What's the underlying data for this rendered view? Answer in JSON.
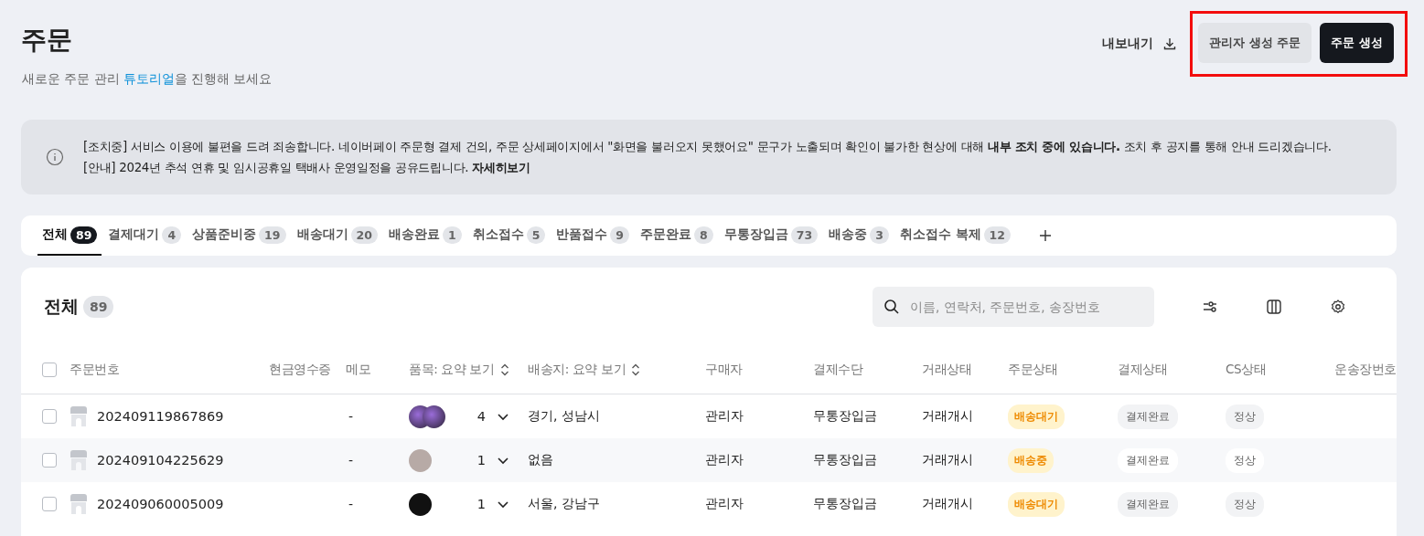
{
  "page": {
    "title": "주문",
    "subtitle_before": "새로운 주문 관리 ",
    "subtitle_link": "튜토리얼",
    "subtitle_after": "을 진행해 보세요"
  },
  "header_actions": {
    "export": "내보내기",
    "buttons": [
      {
        "label": "관리자 생성 주문",
        "kind": "secondary"
      },
      {
        "label": "주문 생성",
        "kind": "primary"
      }
    ]
  },
  "notice": {
    "lines": [
      "[조치중] 서비스 이용에 불편을 드려 죄송합니다. 네이버페이 주문형 결제 건의, 주문 상세페이지에서 \"화면을 불러오지 못했어요\" 문구가 노출되며 확인이 불가한 현상에 대해 **내부 조치 중에 있습니다.** 조치 후 공지를 통해 안내 드리겠습니다.",
      "[안내] 2024년 추석 연휴 및 임시공휴일 택배사 운영일정을 공유드립니다. **자세히보기**"
    ]
  },
  "tabs": [
    {
      "label": "전체",
      "count": "89",
      "selected": true
    },
    {
      "label": "결제대기",
      "count": "4",
      "selected": false
    },
    {
      "label": "상품준비중",
      "count": "19",
      "selected": false
    },
    {
      "label": "배송대기",
      "count": "20",
      "selected": false
    },
    {
      "label": "배송완료",
      "count": "1",
      "selected": false
    },
    {
      "label": "취소접수",
      "count": "5",
      "selected": false
    },
    {
      "label": "반품접수",
      "count": "9",
      "selected": false
    },
    {
      "label": "주문완료",
      "count": "8",
      "selected": false
    },
    {
      "label": "무통장입금",
      "count": "73",
      "selected": false
    },
    {
      "label": "배송중",
      "count": "3",
      "selected": false
    },
    {
      "label": "취소접수 복제",
      "count": "12",
      "selected": false
    }
  ],
  "table": {
    "title": "전체",
    "count": "89",
    "select_all_checked": false,
    "search": {
      "placeholder": "이름, 연락처, 주문번호, 송장번호"
    },
    "columns": [
      "주문번호",
      "현금영수증",
      "메모",
      "품목: 요약 보기",
      "배송지: 요약 보기",
      "구매자",
      "결제수단",
      "거래상태",
      "주문상태",
      "결제상태",
      "CS상태",
      "운송장번호"
    ],
    "rows": [
      {
        "checked": false,
        "order_no": "202409119867869",
        "memo": "-",
        "thumbnail": {
          "kind": "stack"
        },
        "item_count": "4",
        "destination": "경기, 성남시",
        "buyer": "관리자",
        "payment_method": "무통장입금",
        "trade_status": "거래개시",
        "order_status": "배송대기",
        "payment_status": "결제완료",
        "cs_status": "정상"
      },
      {
        "checked": false,
        "order_no": "202409104225629",
        "memo": "-",
        "thumbnail": {
          "kind": "photo"
        },
        "item_count": "1",
        "destination": "없음",
        "buyer": "관리자",
        "payment_method": "무통장입금",
        "trade_status": "거래개시",
        "order_status": "배송중",
        "payment_status": "결제완료",
        "cs_status": "정상"
      },
      {
        "checked": false,
        "order_no": "202409060005009",
        "memo": "-",
        "thumbnail": {
          "kind": "dark"
        },
        "item_count": "1",
        "destination": "서울, 강남구",
        "buyer": "관리자",
        "payment_method": "무통장입금",
        "trade_status": "거래개시",
        "order_status": "배송대기",
        "payment_status": "결제완료",
        "cs_status": "정상"
      }
    ]
  }
}
